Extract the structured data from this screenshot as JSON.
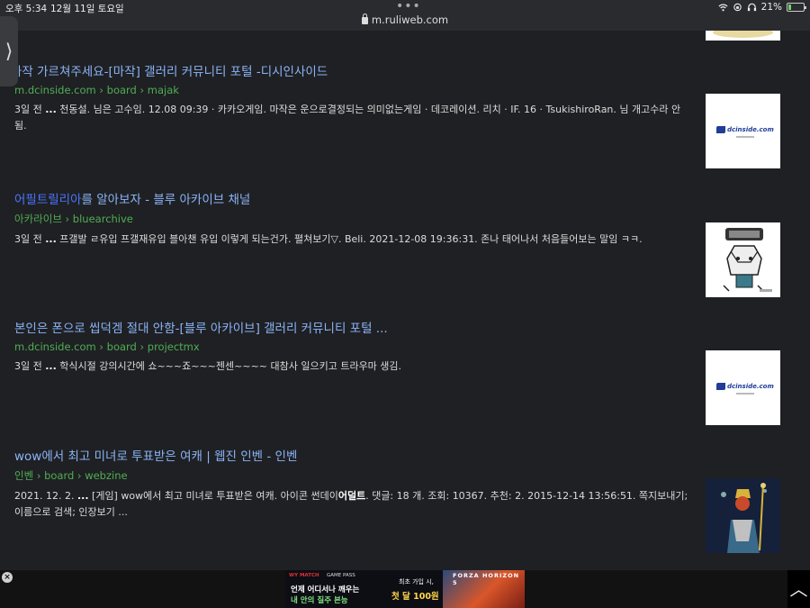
{
  "status": {
    "time": "오후 5:34",
    "date": "12월 11일 토요일",
    "url": "m.ruliweb.com",
    "battery": "21%",
    "battery_level": 0.21
  },
  "sidetab": {
    "glyph": "⟩"
  },
  "results": [
    {
      "title": "마작 가르쳐주세요-[마작] 갤러리 커뮤니티 포털 -디시인사이드",
      "url": "m.dcinside.com › board › majak",
      "snippet_prefix": "3일 전 ",
      "snippet_dots": "...",
      "snippet": " 천동설. 님은 고수임. 12.08 09:39 · 카카오게임. 마작은 운으로결정되는 의미없는게임 · 데코레이션. 리치 · IF. 16 · TsukishiroRan. 님 개고수라 안됨.",
      "thumb_text": "dcinside.com"
    },
    {
      "title_highlight": "어필트릴리아",
      "title_rest": "를 알아보자 - 블루 아카이브 채널",
      "url": "아카라이브 › bluearchive",
      "snippet_prefix": "3일 전 ",
      "snippet_dots": "...",
      "snippet": " 프갤발 ㄹ유입 프갤재유입 블아챈 유입 이렇게 되는건가. 펼쳐보기▽. Beli. 2021-12-08 19:36:31. 존나 태어나서 처음들어보는 말임 ㅋㅋ."
    },
    {
      "title": "본인은 폰으로 씹덕겜 절대 안함-[블루 아카이브] 갤러리 커뮤니티 포털 ...",
      "url": "m.dcinside.com › board › projectmx",
      "snippet_prefix": "3일 전 ",
      "snippet_dots": "...",
      "snippet": " 학식시절 강의시간에 쇼~~~죠~~~젠센~~~~ 대참사 일으키고 트라우마 생김.",
      "thumb_text": "dcinside.com"
    },
    {
      "title": "wow에서 최고 미녀로 투표받은 여캐 | 웹진 인벤 - 인벤",
      "url": "인벤 › board › webzine",
      "snippet_prefix": "2021. 12. 2. ",
      "snippet_dots": "...",
      "snippet_a": " [게임] wow에서 최고 미녀로 투표받은 여캐. 아이콘 썬데이",
      "snippet_bold": "어덜트",
      "snippet_b": ". 댓글: 18 개. 조회: 10367. 추천: 2. 2015-12-14 13:56:51. 쪽지보내기; 이름으로 검색; 인장보기 ..."
    }
  ],
  "ad": {
    "brand": "WY MATCH",
    "gamepass": "GAME PASS",
    "line1": "언제 어디서나 깨우는",
    "line2": "내 안의 질주 본능",
    "promo1": "최초 가입 시,",
    "promo2": "첫 달 100원",
    "game": "FORZA HORIZON 5"
  },
  "footer": {
    "close": "×",
    "scroll_top": "︿"
  },
  "colors": {
    "background": "#1f2023",
    "link": "#8ab4f8",
    "url_green": "#4fae55"
  }
}
